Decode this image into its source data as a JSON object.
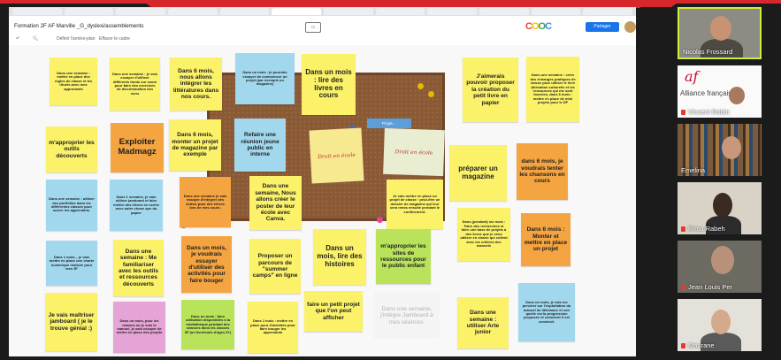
{
  "browser": {
    "tabs": [
      "",
      "",
      "",
      "",
      "",
      "",
      "",
      "",
      "",
      "",
      "",
      ""
    ],
    "doc_title": "Formation 2F AF Marville _G_dyslexi/assemblements",
    "toolbar": {
      "zoom_label": "",
      "a": "Définir l'arrière-plan",
      "b": "Effacer le cadre"
    },
    "brand_letters": [
      "C",
      "O",
      "O",
      "C"
    ],
    "share_label": "Partager",
    "banner": "Projet…",
    "accent": "#1a73e8"
  },
  "notes": {
    "n1": "Dans une semaine : mettre en place des règles de classe et les rituels avec mes apprenants",
    "n2": "Dans une semaine : je vais essayer d'utiliser différents fonds sur zoom pour faire des exercices de discrimination des sons",
    "n3": "Dans 6 mois, nous allons intégrer les littératures dans nos cours.",
    "n4": "Dans un mois : je pourrais essayer de commencer un projet (par exemple un magazine)",
    "n5": "Dans un mois : lire des livres en cours",
    "n6": "J'aimerais pouvoir proposer la création du petit livre en papier",
    "n7": "Dans une semaine : créer des échanges pratiques de classe pour utiliser le livre Aliénation culturelle et les ressources qui me sont fournies, dans 6 mois : mettre en place de mini projets pour le DF",
    "n8": "m'approprier les outils découverts",
    "n9": "Exploiter Madmagz",
    "n10": "Dans 6 mois, monter un projet de magazine par exemple",
    "n11": "Refaire une réunion jeune public en interne",
    "n12": "préparer un magazine",
    "n13": "dans 6 mois, je voudrais tenter les chansons en cours",
    "n14": "Dans une semaine : utiliser des portfolios dans les différentes classes pour suivre les apprenants.",
    "n15": "Dans 1 semaine, je vais utiliser jamboard et faire mettre des élèves en scène avec autre chose que du papier",
    "n16": "Dans une semaine je vais essayer d'intégrer des vidéos pour des élèves lors de mes cours.",
    "n17": "Dans une semaine, Nous allons créer le poster de leur école avec Canva.",
    "n18": "Je vais mettre en place un projet de classe : peut-être un dossier de magazine qui leur sera remis ensuite pendant le confinement.",
    "n19": "Dans (pendant) six mois : Faire des recherches et faire une base de projets à des livres que je veux utiliser en classe qui collent avec les critères des manuels",
    "n20": "Dans 6 mois : Monter et mettre en place un projet",
    "n21": "Dans 1 mois... je vais mettre en place une charte numérique réalisée pour mes 3F",
    "n22": "Dans une semaine : Me familiariser avec les outils et ressources découverts",
    "n23": "Dans un mois, je voudrais essayer d'utiliser des activités pour faire bouger",
    "n24": "Proposer un parcours de \"summer camps\" en ligne",
    "n25": "Dans un mois, lire des histoires",
    "n26": "m'approprier les sites de ressources pour le public enfant",
    "n27": "Je vais maîtriser jamboard ( je le trouve génial :)",
    "n28": "Dans un mois, pour les classes où je suis le manuel, je vais essayer de mettre en place des projets",
    "n29": "Dans un mois : faire utilisation disponibles à la médiathèque pendant des séances dans les classes 3F (un livre/mois d'ages 3+)",
    "n30": "Dans 1 mois : mettre en place pour d'activités pour faire bouger les apprenants",
    "n31": "faire un petit projet que l'on peut afficher",
    "n32": "Dans une semaine, j'intègre Jamboard à mes séances.",
    "n33": "Dans une semaine : utiliser Arte junior",
    "n34": "Dans un mois, je vais me pencher sur l'exploitation du manuel de littérature et voir quelle est la progression proposée et comment il est construit."
  },
  "papers": {
    "p1": "Droit en école",
    "p2": "Droit en école"
  },
  "participants": [
    {
      "name": "Nicolas Frossard",
      "speaking": true
    },
    {
      "name": "Vincent Robin",
      "logo_text": "Alliance française"
    },
    {
      "name": "Emelina"
    },
    {
      "name": "Rima Rabeh"
    },
    {
      "name": "Jean Louis Per"
    },
    {
      "name": "Maurane"
    }
  ],
  "colors": {
    "yellow": "#fbf26a",
    "orange": "#f4a441",
    "blue": "#a2d8ee",
    "green": "#b9e35a",
    "pink": "#e5a3d6",
    "red_brand": "#d6272b"
  }
}
